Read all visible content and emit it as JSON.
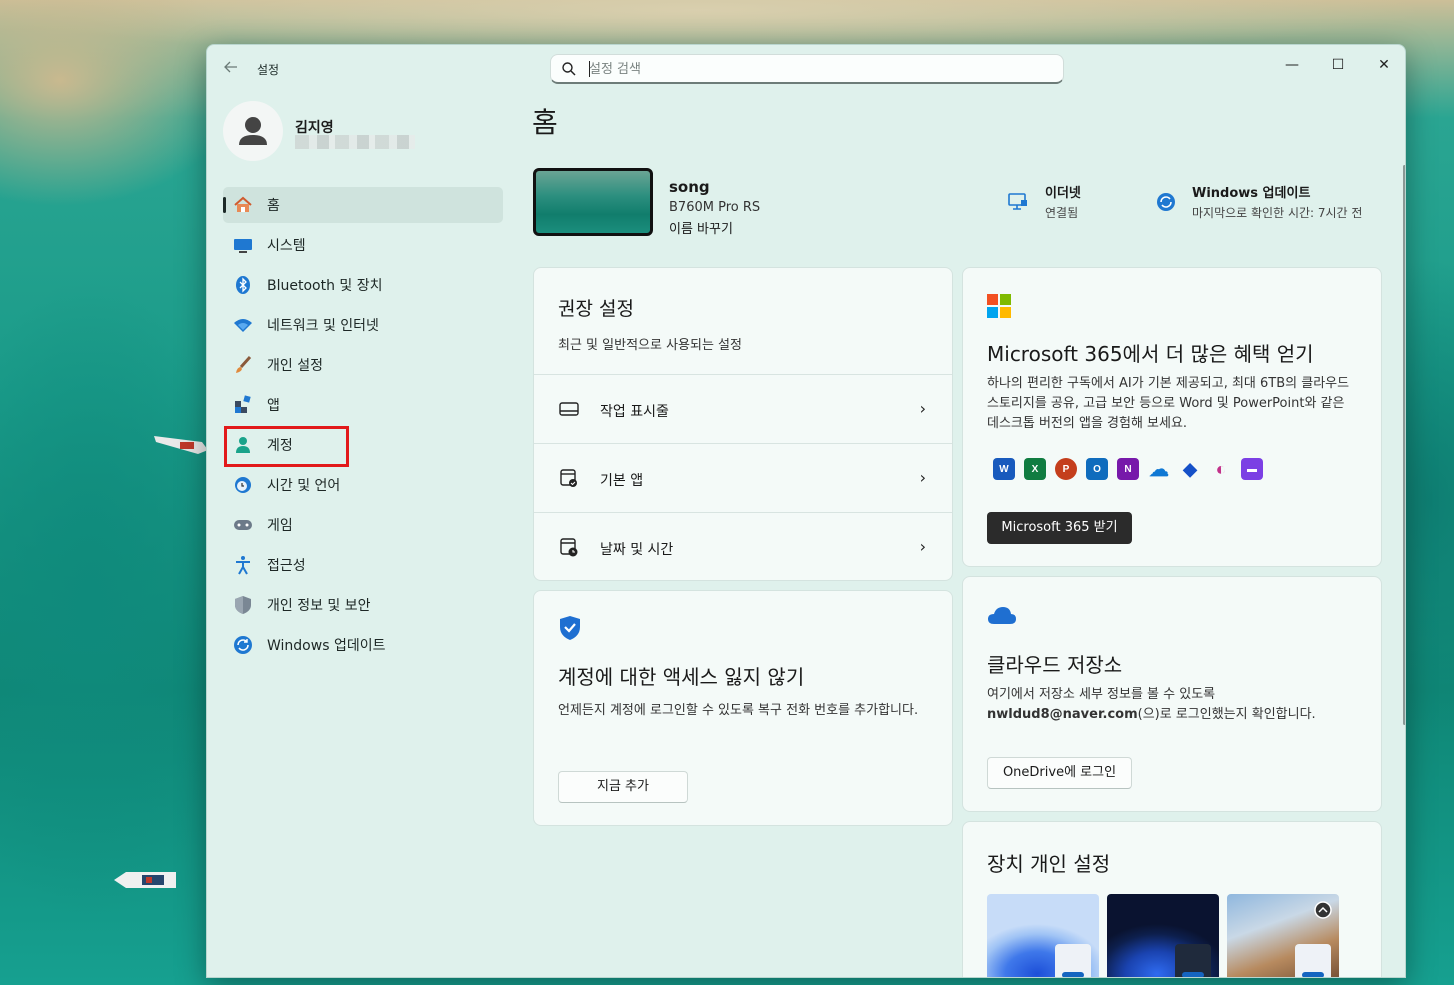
{
  "window": {
    "app_title": "설정",
    "search_placeholder": "설정 검색",
    "controls": {
      "minimize": "—",
      "maximize": "☐",
      "close": "✕"
    }
  },
  "profile": {
    "name": "김지영"
  },
  "sidebar": {
    "items": [
      {
        "label": "홈",
        "icon": "home-icon",
        "active": true
      },
      {
        "label": "시스템",
        "icon": "system-icon"
      },
      {
        "label": "Bluetooth 및 장치",
        "icon": "bluetooth-icon"
      },
      {
        "label": "네트워크 및 인터넷",
        "icon": "wifi-icon"
      },
      {
        "label": "개인 설정",
        "icon": "brush-icon"
      },
      {
        "label": "앱",
        "icon": "apps-icon"
      },
      {
        "label": "계정",
        "icon": "account-icon",
        "highlighted": true
      },
      {
        "label": "시간 및 언어",
        "icon": "time-language-icon"
      },
      {
        "label": "게임",
        "icon": "gamepad-icon"
      },
      {
        "label": "접근성",
        "icon": "accessibility-icon"
      },
      {
        "label": "개인 정보 및 보안",
        "icon": "shield-icon"
      },
      {
        "label": "Windows 업데이트",
        "icon": "update-icon"
      }
    ]
  },
  "main": {
    "title": "홈",
    "device": {
      "name": "song",
      "model": "B760M Pro RS",
      "rename": "이름 바꾸기"
    },
    "status": {
      "ethernet": {
        "title": "이더넷",
        "sub": "연결됨"
      },
      "update": {
        "title": "Windows 업데이트",
        "sub": "마지막으로 확인한 시간: 7시간 전"
      }
    },
    "recommended": {
      "title": "권장 설정",
      "subtitle": "최근 및 일반적으로 사용되는 설정",
      "rows": [
        {
          "label": "작업 표시줄",
          "icon": "taskbar-icon"
        },
        {
          "label": "기본 앱",
          "icon": "default-apps-icon"
        },
        {
          "label": "날짜 및 시간",
          "icon": "date-time-icon"
        }
      ],
      "chevron": "›"
    },
    "security": {
      "title": "계정에 대한 액세스 잃지 않기",
      "body": "언제든지 계정에 로그인할 수 있도록 복구 전화 번호를 추가합니다.",
      "button": "지금 추가"
    },
    "m365": {
      "title": "Microsoft 365에서 더 많은 혜택 얻기",
      "body": "하나의 편리한 구독에서 AI가 기본 제공되고, 최대 6TB의 클라우드 스토리지를 공유, 고급 보안 등으로 Word 및 PowerPoint와 같은 데스크톱 버전의 앱을 경험해 보세요.",
      "button": "Microsoft 365 받기",
      "apps": [
        {
          "name": "word-icon",
          "glyph": "W",
          "color": "#185abd"
        },
        {
          "name": "excel-icon",
          "glyph": "X",
          "color": "#107c41"
        },
        {
          "name": "powerpoint-icon",
          "glyph": "P",
          "color": "#c43e1c"
        },
        {
          "name": "outlook-icon",
          "glyph": "O",
          "color": "#0f6cbd"
        },
        {
          "name": "onenote-icon",
          "glyph": "N",
          "color": "#7719aa"
        },
        {
          "name": "onedrive-icon",
          "glyph": "☁",
          "color": "#0f78d4"
        },
        {
          "name": "defender-icon",
          "glyph": "◆",
          "color": "#1550c8"
        },
        {
          "name": "copilot-icon",
          "glyph": "◐",
          "color": "#c2318a"
        },
        {
          "name": "clipchamp-icon",
          "glyph": "▬",
          "color": "#7b3fe4"
        }
      ]
    },
    "cloud": {
      "title": "클라우드 저장소",
      "body_line1": "여기에서 저장소 세부 정보를 볼 수 있도록",
      "email": "nwldud8@naver.com",
      "body_line2": "(으)로 로그인했는지 확인합니다.",
      "button": "OneDrive에 로그인"
    },
    "personalize": {
      "title": "장치 개인 설정"
    }
  }
}
